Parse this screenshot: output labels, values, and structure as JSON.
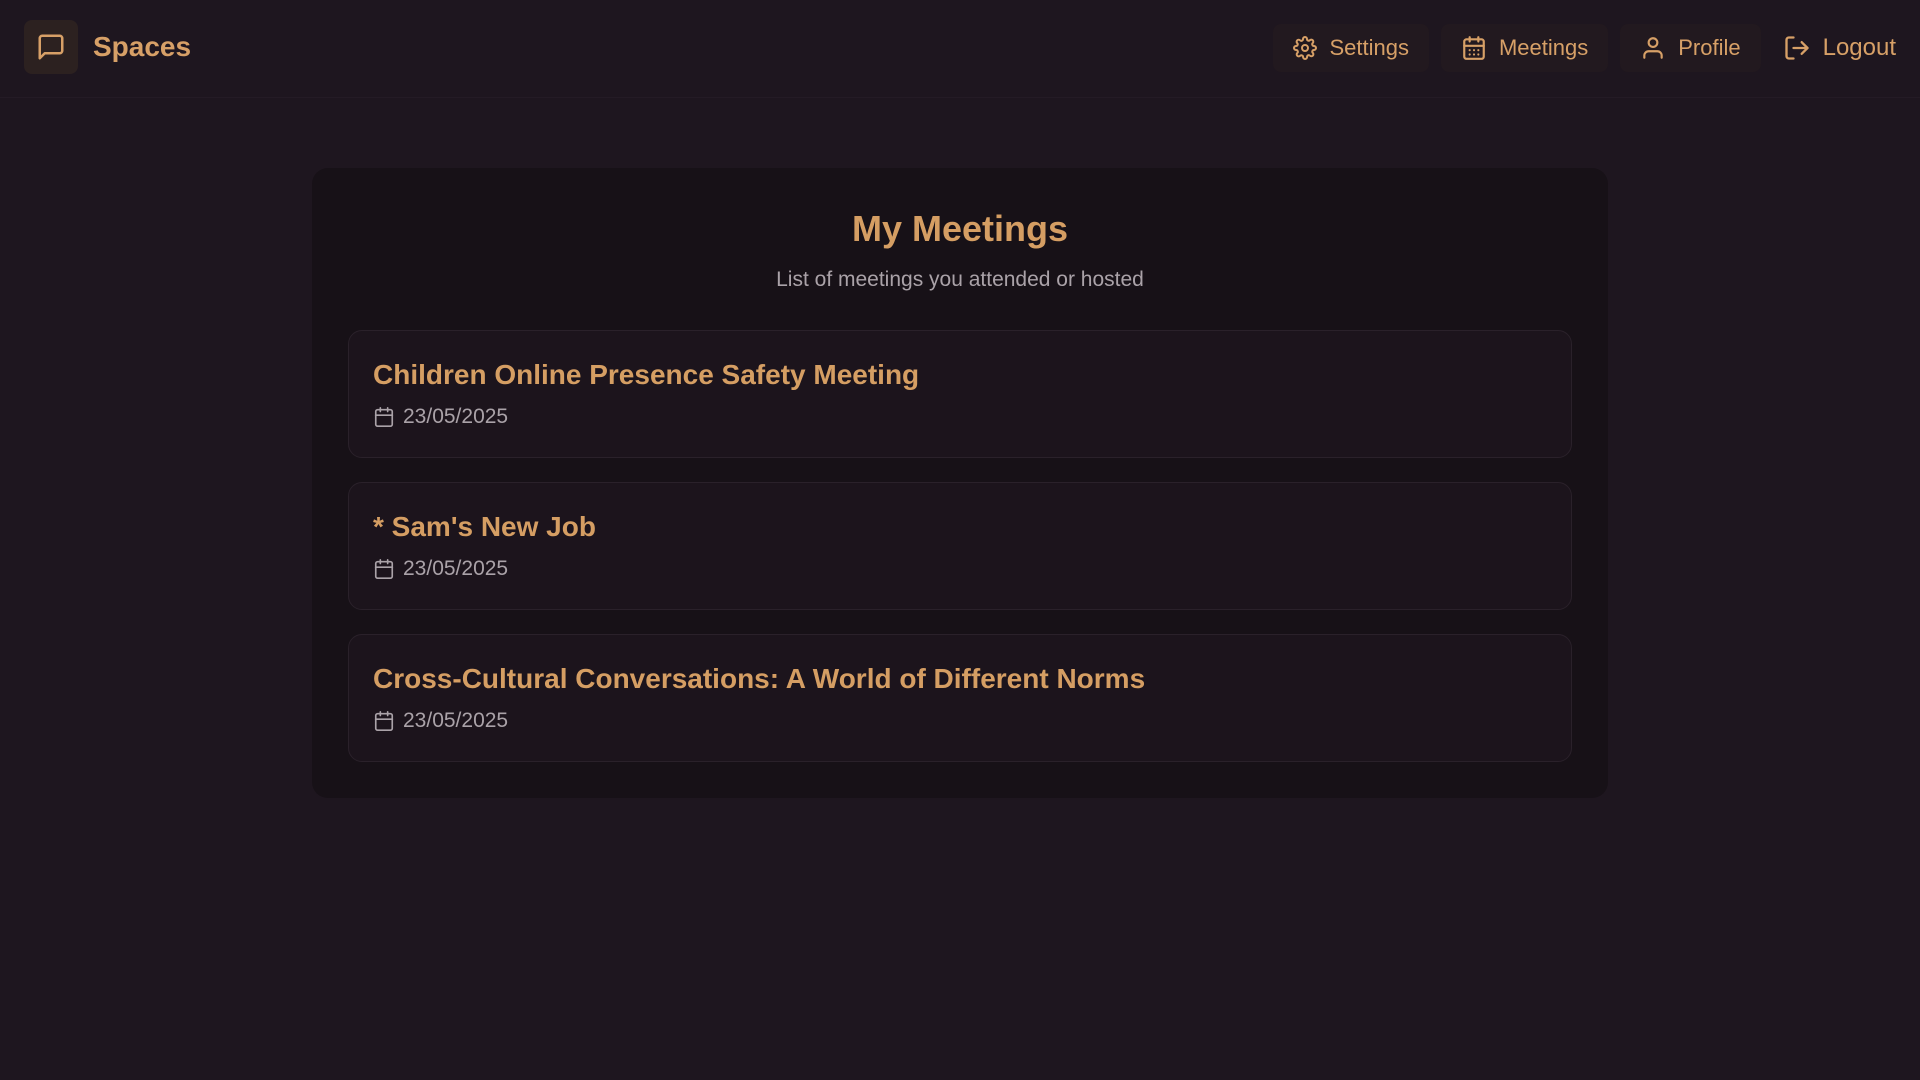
{
  "app": {
    "name": "Spaces",
    "logo_icon": "message-square-icon"
  },
  "nav": {
    "settings": {
      "label": "Settings",
      "icon": "gear-icon"
    },
    "meetings": {
      "label": "Meetings",
      "icon": "calendar-icon"
    },
    "profile": {
      "label": "Profile",
      "icon": "user-icon"
    },
    "logout": {
      "label": "Logout",
      "icon": "logout-icon"
    }
  },
  "main": {
    "title": "My Meetings",
    "subtitle": "List of meetings you attended or hosted",
    "meetings": [
      {
        "title": "Children Online Presence Safety Meeting",
        "date": "23/05/2025"
      },
      {
        "title": "* Sam's New Job",
        "date": "23/05/2025"
      },
      {
        "title": "Cross-Cultural Conversations: A World of Different Norms",
        "date": "23/05/2025"
      }
    ]
  },
  "colors": {
    "background": "#1e161f",
    "panel": "#171117",
    "card": "#1c141c",
    "accent": "#d59e63",
    "muted_text": "#aaa2a8"
  }
}
